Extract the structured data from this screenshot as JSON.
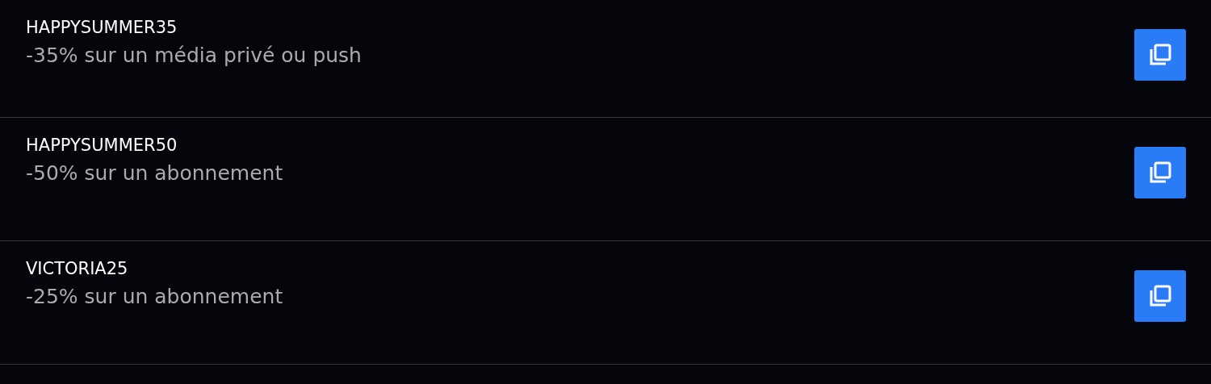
{
  "codes": [
    {
      "code": "HAPPYSUMMER35",
      "description": "-35% sur un média privé ou push"
    },
    {
      "code": "HAPPYSUMMER50",
      "description": "-50% sur un abonnement"
    },
    {
      "code": "VICTORIA25",
      "description": "-25% sur un abonnement"
    }
  ]
}
